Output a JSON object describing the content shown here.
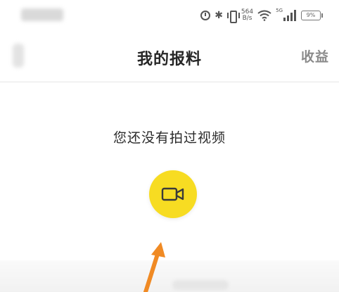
{
  "status_bar": {
    "network_speed_value": "564",
    "network_speed_unit": "B/s",
    "network_type": "5G",
    "battery": "9%",
    "icons": [
      "alarm-icon",
      "bluetooth-icon",
      "vibrate-icon",
      "wifi-icon",
      "signal-icon",
      "battery-icon"
    ]
  },
  "header": {
    "title": "我的报料",
    "right_action": "收益",
    "back_icon": "back-arrow-icon"
  },
  "empty_state": {
    "message": "您还没有拍过视频",
    "record_button_icon": "video-camera-icon"
  },
  "colors": {
    "accent_yellow": "#f7dc22",
    "annotation_arrow": "#f08a24",
    "title_text": "#262626",
    "muted_text": "#8a8a8a"
  }
}
